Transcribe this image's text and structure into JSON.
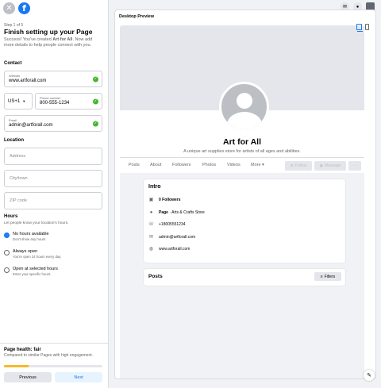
{
  "left": {
    "step": "Step 1 of 5",
    "title": "Finish setting up your Page",
    "subtitle_prefix": "Success! You've created ",
    "subtitle_page": "Art for All",
    "subtitle_suffix": ". Now add more details to help people connect with you.",
    "contact_label": "Contact",
    "website_label": "Website",
    "website_value": "www.artforall.com",
    "country_code": "US+1",
    "phone_label": "Phone number",
    "phone_value": "800-555-1234",
    "email_label": "Email",
    "email_value": "admin@artforall.com",
    "location_label": "Location",
    "address_placeholder": "Address",
    "city_placeholder": "City/town",
    "zip_placeholder": "ZIP code",
    "hours_label": "Hours",
    "hours_sub": "Let people know your location's hours.",
    "hours_options": [
      {
        "title": "No hours available",
        "sub": "Don't show any hours.",
        "selected": true
      },
      {
        "title": "Always open",
        "sub": "You're open 24 hours every day.",
        "selected": false
      },
      {
        "title": "Open at selected hours",
        "sub": "Enter your specific hours.",
        "selected": false
      }
    ],
    "health_title": "Page health: fair",
    "health_sub": "Compared to similar Pages with high engagement.",
    "health_progress": 0.25,
    "previous_label": "Previous",
    "next_label": "Next"
  },
  "preview": {
    "label": "Desktop Preview",
    "page_name": "Art for All",
    "page_desc": "A unique art supplies store for artists of all ages and abilities.",
    "tabs": [
      "Posts",
      "About",
      "Followers",
      "Photos",
      "Videos",
      "More ▾"
    ],
    "follow_label": "Follow",
    "message_label": "Message",
    "more_label": "···",
    "intro_title": "Intro",
    "intro_items": [
      {
        "icon": "followers-icon",
        "text": "0 Followers",
        "bold": true
      },
      {
        "icon": "info-icon",
        "text_bold": "Page",
        "text": " · Arts & Crafts Store"
      },
      {
        "icon": "phone-icon",
        "text": "+18005551234"
      },
      {
        "icon": "email-icon",
        "text": "admin@artforall.com"
      },
      {
        "icon": "globe-icon",
        "text": "www.artforall.com"
      }
    ],
    "posts_title": "Posts",
    "filters_label": "Filters"
  },
  "colors": {
    "brand": "#1877f2",
    "success": "#42b72a",
    "health_bar": "#f7b928"
  }
}
